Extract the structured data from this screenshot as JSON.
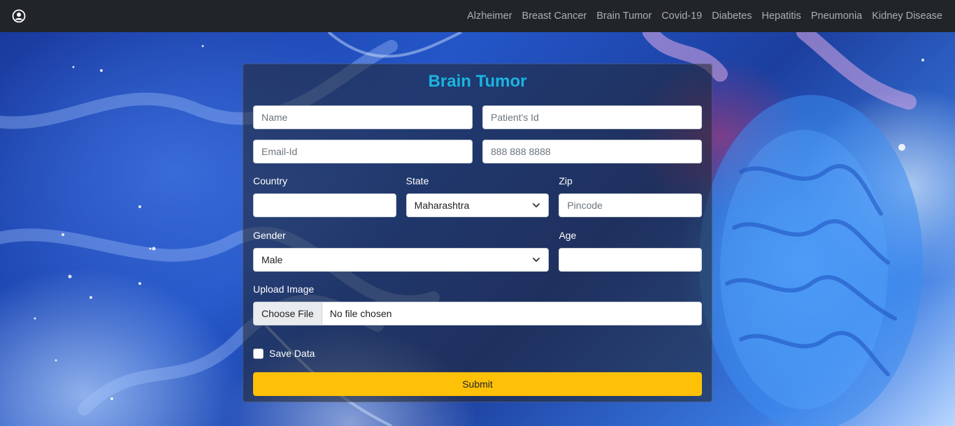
{
  "nav": {
    "brand_icon": "user-circle-icon",
    "links": [
      "Alzheimer",
      "Breast Cancer",
      "Brain Tumor",
      "Covid-19",
      "Diabetes",
      "Hepatitis",
      "Pneumonia",
      "Kidney Disease"
    ]
  },
  "form": {
    "title": "Brain Tumor",
    "name_placeholder": "Name",
    "patient_id_placeholder": "Patient's Id",
    "email_placeholder": "Email-Id",
    "phone_placeholder": "888 888 8888",
    "country_label": "Country",
    "country_value": "",
    "state_label": "State",
    "state_value": "Maharashtra",
    "zip_label": "Zip",
    "zip_placeholder": "Pincode",
    "gender_label": "Gender",
    "gender_value": "Male",
    "age_label": "Age",
    "age_value": "",
    "upload_label": "Upload Image",
    "file_button": "Choose File",
    "file_status": "No file chosen",
    "save_label": "Save Data",
    "submit_label": "Submit"
  },
  "colors": {
    "navbar": "#212529",
    "title": "#1ab5e0",
    "submit": "#ffc107"
  }
}
